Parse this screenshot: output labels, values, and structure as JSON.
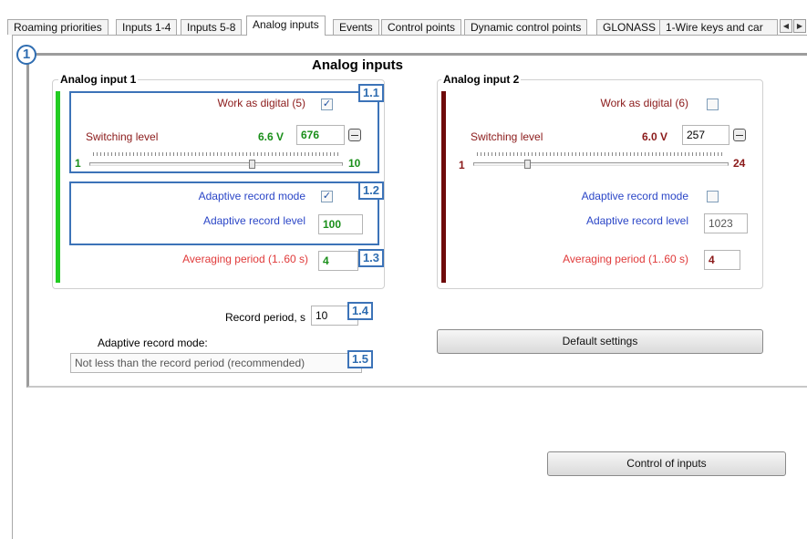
{
  "tabs": [
    {
      "label": "Roaming priorities"
    },
    {
      "label": "Inputs 1-4"
    },
    {
      "label": "Inputs 5-8"
    },
    {
      "label": "Analog inputs"
    },
    {
      "label": "Events"
    },
    {
      "label": "Control points"
    },
    {
      "label": "Dynamic control points"
    },
    {
      "label": "GLONASS"
    },
    {
      "label": "1-Wire keys and car"
    }
  ],
  "active_tab": "Analog inputs",
  "tab_scroll": {
    "left": "◀",
    "right": "▶"
  },
  "panel": {
    "badge": "1",
    "title": "Analog inputs"
  },
  "input1": {
    "title": "Analog input 1",
    "bar_color": "#22cc22",
    "work_as_digital": {
      "label": "Work as digital (5)",
      "checked": true,
      "mark": "✓"
    },
    "switching_level": {
      "label": "Switching level",
      "voltage": "6.6 V",
      "value": "676"
    },
    "slider": {
      "min": "1",
      "max": "10",
      "position": 0.64
    },
    "adaptive_mode": {
      "label": "Adaptive record mode",
      "checked": true,
      "mark": "✓"
    },
    "adaptive_level": {
      "label": "Adaptive record level",
      "value": "100"
    },
    "averaging": {
      "label": "Averaging period (1..60 s)",
      "value": "4"
    }
  },
  "input2": {
    "title": "Analog input 2",
    "bar_color": "#6e0a0a",
    "work_as_digital": {
      "label": "Work as digital (6)",
      "checked": false,
      "mark": ""
    },
    "switching_level": {
      "label": "Switching level",
      "voltage": "6.0 V",
      "value": "257"
    },
    "slider": {
      "min": "1",
      "max": "24",
      "position": 0.21
    },
    "adaptive_mode": {
      "label": "Adaptive record mode",
      "checked": false,
      "mark": ""
    },
    "adaptive_level": {
      "label": "Adaptive record level",
      "value": "1023"
    },
    "averaging": {
      "label": "Averaging period (1..60 s)",
      "value": "4"
    }
  },
  "badges": {
    "b11": "1.1",
    "b12": "1.2",
    "b13": "1.3",
    "b14": "1.4",
    "b15": "1.5"
  },
  "record_period": {
    "label": "Record period, s",
    "value": "10"
  },
  "adaptive_record_mode": {
    "label": "Adaptive record mode:",
    "value": "Not less than the record period (recommended)"
  },
  "buttons": {
    "default_settings": "Default settings",
    "control_of_inputs": "Control of inputs"
  },
  "colors": {
    "accent_blue": "#3c73b8",
    "green": "#1a8f1a",
    "dark_red": "#8b1a1a"
  }
}
